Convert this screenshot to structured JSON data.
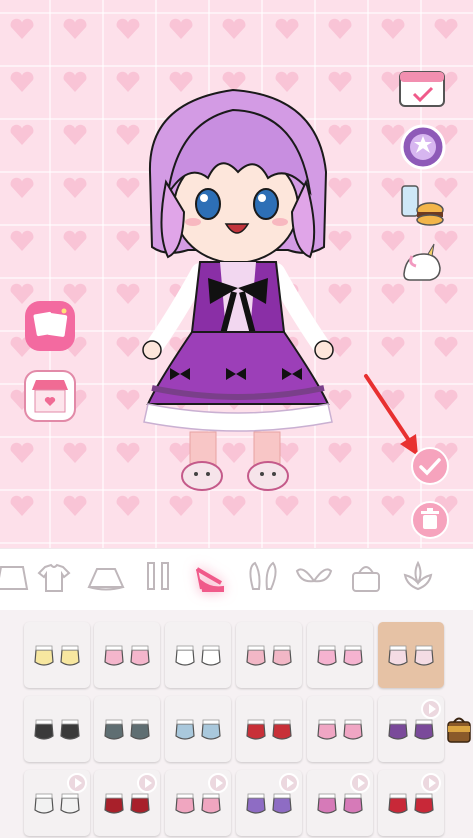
{
  "scene": {
    "background": "pink-heart-pattern",
    "colors": {
      "background": "#fde0ea",
      "heart": "#f9c4d6",
      "accent": "#f05a8a"
    }
  },
  "side_buttons": {
    "left": [
      {
        "name": "photo-album-icon"
      },
      {
        "name": "shop-icon"
      }
    ],
    "right": [
      {
        "name": "calendar-icon"
      },
      {
        "name": "star-badge-icon"
      },
      {
        "name": "food-icon"
      },
      {
        "name": "unicorn-icon"
      }
    ],
    "actions": [
      {
        "name": "confirm-check-icon"
      },
      {
        "name": "trash-icon"
      }
    ]
  },
  "character": {
    "hair_color": "#c98ee0",
    "dress_color": "#9b3fb4"
  },
  "categories": [
    {
      "name": "cape-icon"
    },
    {
      "name": "shirt-icon"
    },
    {
      "name": "skirt-icon"
    },
    {
      "name": "stockings-icon"
    },
    {
      "name": "shoes-icon",
      "active": true
    },
    {
      "name": "ears-icon"
    },
    {
      "name": "wings-icon"
    },
    {
      "name": "bag-icon"
    },
    {
      "name": "flower-icon"
    }
  ],
  "shoe_items": [
    {
      "name": "yellow-socks-shoes",
      "color": "#f7e7a0",
      "locked": false
    },
    {
      "name": "pink-maryjane-shoes",
      "color": "#f4b6cc",
      "locked": false
    },
    {
      "name": "bunny-slippers",
      "color": "#ffffff",
      "locked": false
    },
    {
      "name": "pink-boots",
      "color": "#f2b7c6",
      "locked": false
    },
    {
      "name": "pink-flats",
      "color": "#f5b3d0",
      "locked": false
    },
    {
      "name": "white-pink-slippers",
      "color": "#f4dce4",
      "locked": false,
      "selected": true
    },
    {
      "name": "black-strap-sandals",
      "color": "#3a3a3a",
      "locked": false
    },
    {
      "name": "gray-bow-shoes",
      "color": "#5f6e72",
      "locked": false
    },
    {
      "name": "blue-bow-shoes",
      "color": "#a9c8dc",
      "locked": false
    },
    {
      "name": "red-heels",
      "color": "#c83038",
      "locked": false
    },
    {
      "name": "pink-heels",
      "color": "#f0a6c4",
      "locked": false
    },
    {
      "name": "purple-gold-heels",
      "color": "#7a4a9a",
      "locked": true
    },
    {
      "name": "white-flats",
      "color": "#f2f2f2",
      "locked": true
    },
    {
      "name": "red-maryjanes",
      "color": "#a8202a",
      "locked": true
    },
    {
      "name": "pink-bow-flats",
      "color": "#f0a6c0",
      "locked": true
    },
    {
      "name": "purple-bow-shoes",
      "color": "#8e6cc4",
      "locked": true
    },
    {
      "name": "pink-ribbon-shoes",
      "color": "#d67ab8",
      "locked": true
    },
    {
      "name": "red-bow-shoes",
      "color": "#c82838",
      "locked": true
    }
  ]
}
